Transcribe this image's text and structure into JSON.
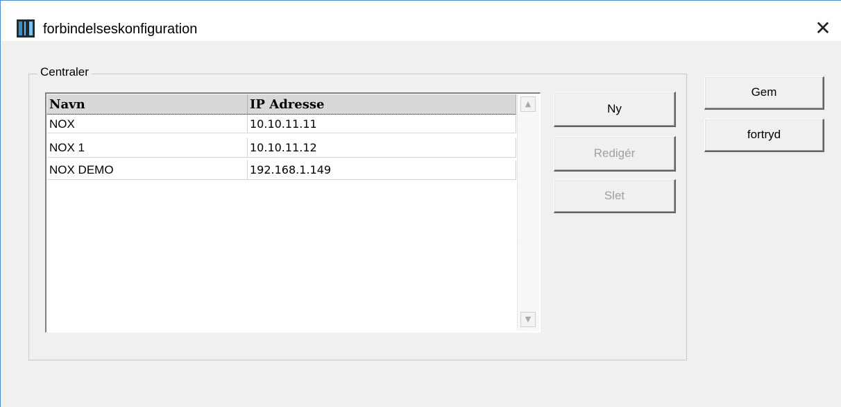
{
  "window": {
    "title": "forbindelseskonfiguration",
    "close_glyph": "✕"
  },
  "group": {
    "legend": "Centraler"
  },
  "list": {
    "columns": [
      "Navn",
      "IP Adresse"
    ],
    "rows": [
      {
        "navn": "NOX",
        "ip": "10.10.11.11"
      },
      {
        "navn": "NOX 1",
        "ip": "10.10.11.12"
      },
      {
        "navn": "NOX DEMO",
        "ip": "192.168.1.149"
      }
    ],
    "scroll_up_glyph": "▲",
    "scroll_down_glyph": "▼"
  },
  "buttons": {
    "ny": "Ny",
    "rediger": "Redigér",
    "slet": "Slet",
    "gem": "Gem",
    "fortryd": "fortryd"
  }
}
